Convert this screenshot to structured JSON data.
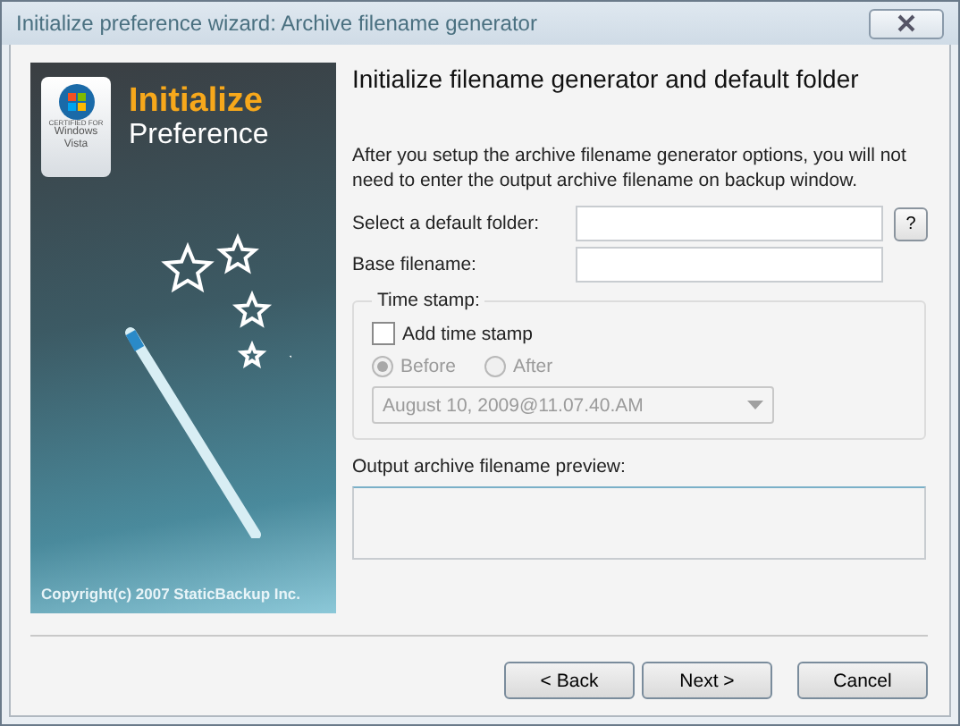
{
  "window": {
    "title": "Initialize preference wizard: Archive filename generator"
  },
  "banner": {
    "badge_lines": [
      "CERTIFIED FOR",
      "Windows",
      "Vista"
    ],
    "title_top": "Initialize",
    "title_bottom": "Preference",
    "copyright": "Copyright(c) 2007 StaticBackup Inc."
  },
  "heading": "Initialize filename generator and default folder",
  "description": "After you setup the archive filename generator options, you will not need to enter the output archive filename on backup window.",
  "fields": [
    {
      "label": "Select a default folder:",
      "help": "?"
    },
    {
      "label": "Base filename:"
    }
  ],
  "time_stamp": {
    "legend": "Time stamp:",
    "checkbox": {
      "label": "Add time stamp",
      "checked": false
    },
    "disabled": true,
    "radios": [
      {
        "label": "Before",
        "selected": true
      },
      {
        "label": "After",
        "selected": false
      }
    ],
    "dropdown": {
      "value": "August 10, 2009@11.07.40.AM"
    }
  },
  "preview": {
    "label": "Output archive filename preview:"
  },
  "buttons": [
    "< Back",
    "Next >",
    "Cancel"
  ]
}
